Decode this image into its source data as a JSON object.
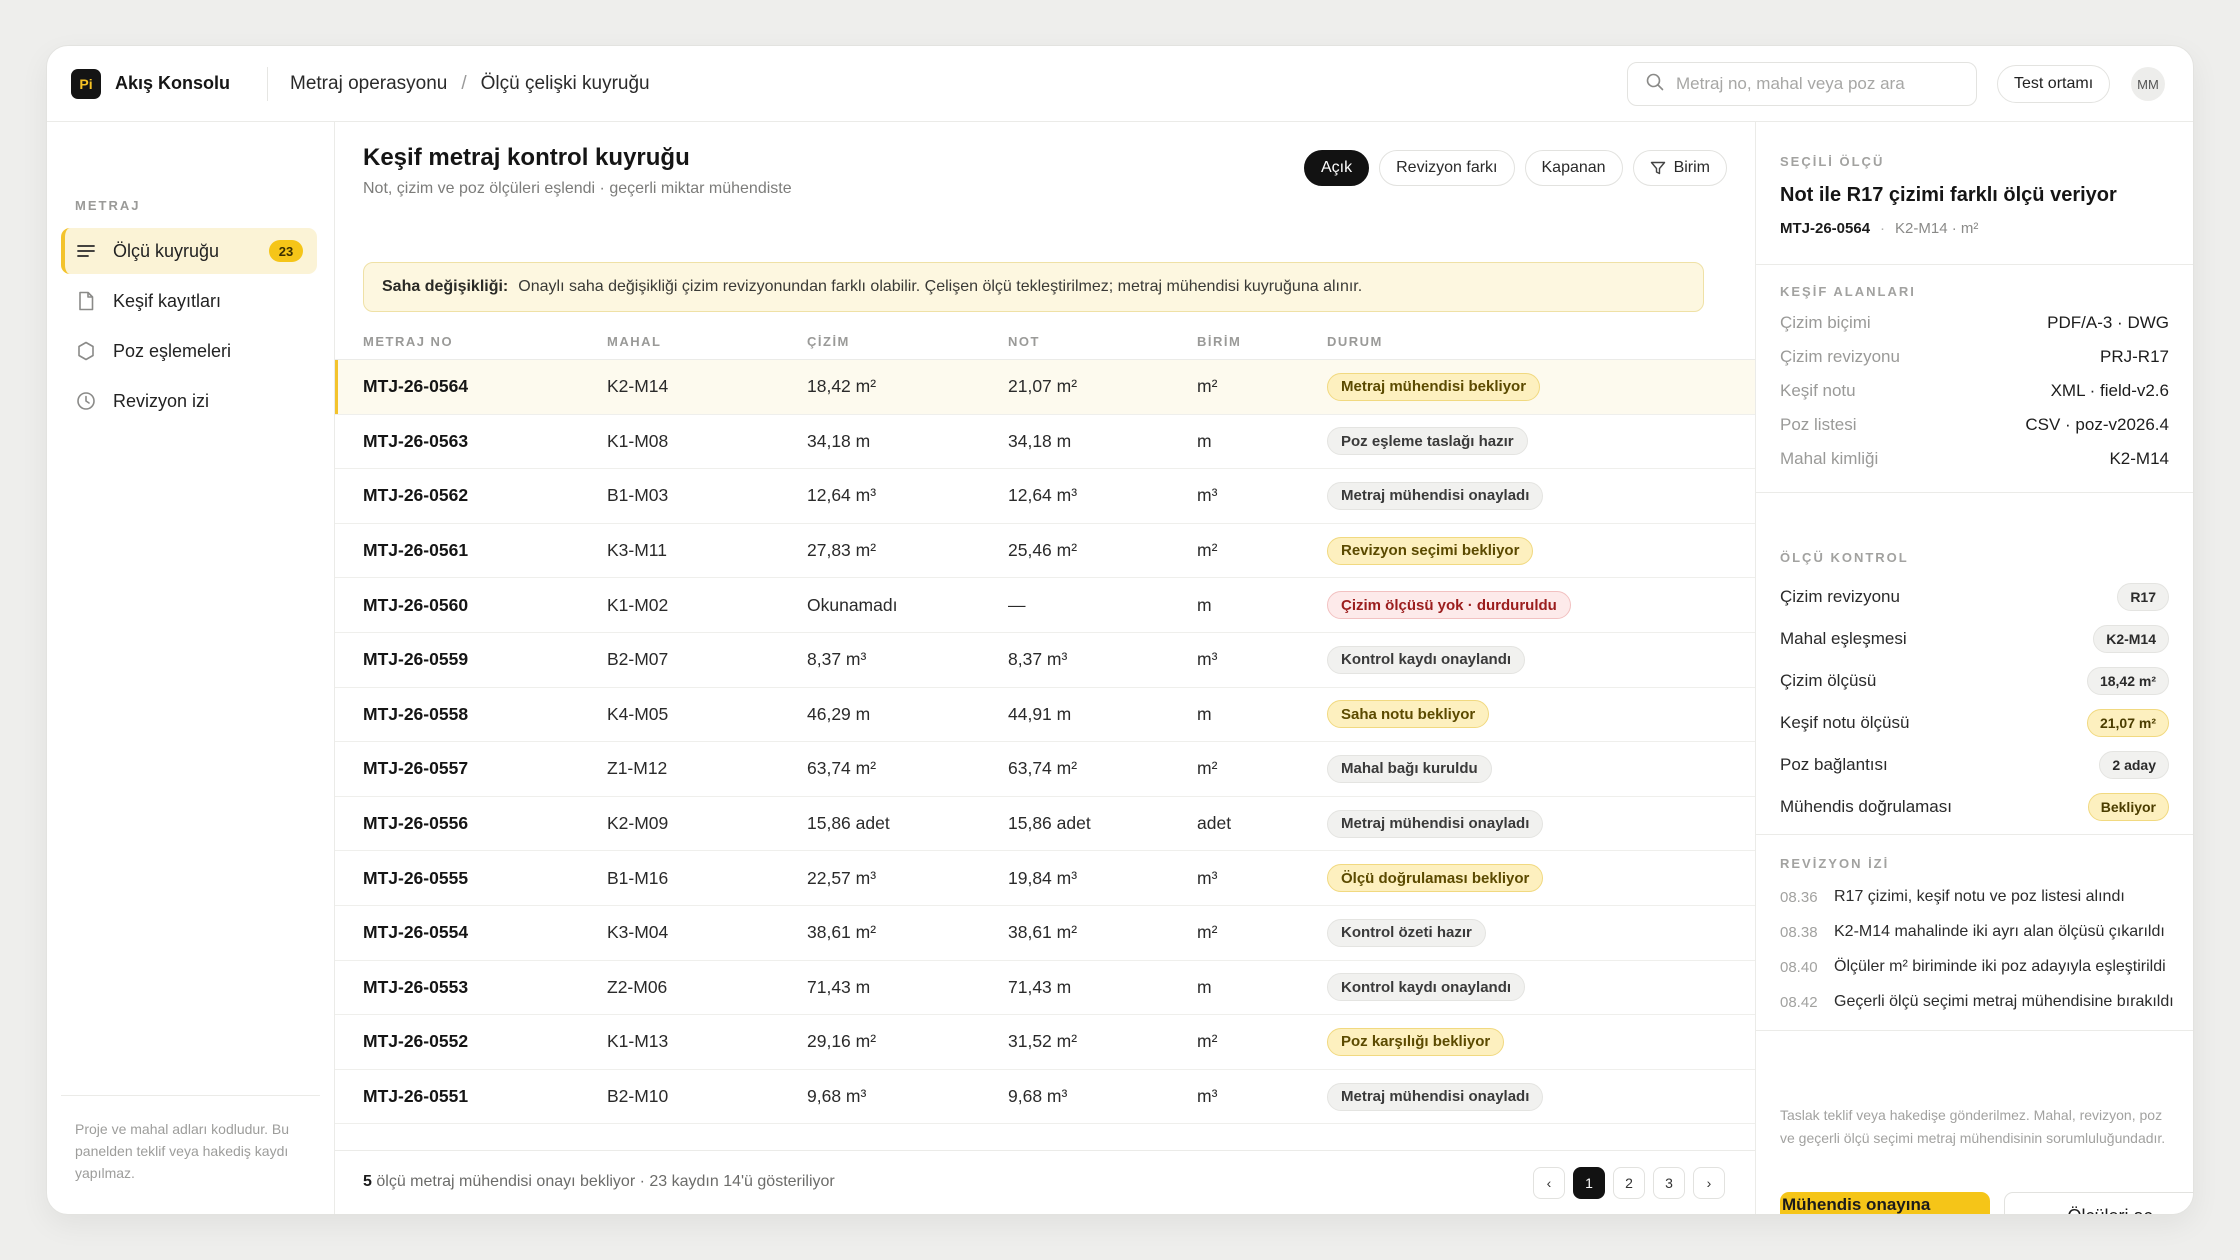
{
  "app": {
    "logo_text": "Pi",
    "brand": "Akış Konsolu",
    "breadcrumb": [
      "Metraj operasyonu",
      "Ölçü çelişki kuyruğu"
    ],
    "breadcrumb_sep": "/",
    "search_placeholder": "Metraj no, mahal veya poz ara",
    "env_label": "Test ortamı",
    "avatar": "MM"
  },
  "sidebar": {
    "heading": "METRAJ",
    "items": [
      {
        "label": "Ölçü kuyruğu",
        "icon": "list-icon",
        "badge": "23",
        "active": true
      },
      {
        "label": "Keşif kayıtları",
        "icon": "document-icon"
      },
      {
        "label": "Poz eşlemeleri",
        "icon": "hexagon-icon"
      },
      {
        "label": "Revizyon izi",
        "icon": "clock-icon"
      }
    ],
    "note": "Proje ve mahal adları kodludur. Bu panelden teklif veya hakediş kaydı yapılmaz."
  },
  "main": {
    "title": "Keşif metraj kontrol kuyruğu",
    "subtitle": "Not, çizim ve poz ölçüleri eşlendi · geçerli miktar mühendiste",
    "filters": [
      "Açık",
      "Revizyon farkı",
      "Kapanan",
      "Birim"
    ],
    "alert": {
      "label": "Saha değişikliği:",
      "text": "Onaylı saha değişikliği çizim revizyonundan farklı olabilir. Çelişen ölçü tekleştirilmez; metraj mühendisi kuyruğuna alınır."
    },
    "columns": [
      "METRAJ NO",
      "MAHAL",
      "ÇİZİM",
      "NOT",
      "BİRİM",
      "DURUM"
    ],
    "rows": [
      {
        "no": "MTJ-26-0564",
        "mahal": "K2-M14",
        "cizim": "18,42 m²",
        "not": "21,07 m²",
        "birim": "m²",
        "durum": "Metraj mühendisi bekliyor",
        "tone": "warn"
      },
      {
        "no": "MTJ-26-0563",
        "mahal": "K1-M08",
        "cizim": "34,18 m",
        "not": "34,18 m",
        "birim": "m",
        "durum": "Poz eşleme taslağı hazır",
        "tone": "neutral"
      },
      {
        "no": "MTJ-26-0562",
        "mahal": "B1-M03",
        "cizim": "12,64 m³",
        "not": "12,64 m³",
        "birim": "m³",
        "durum": "Metraj mühendisi onayladı",
        "tone": "neutral"
      },
      {
        "no": "MTJ-26-0561",
        "mahal": "K3-M11",
        "cizim": "27,83 m²",
        "not": "25,46 m²",
        "birim": "m²",
        "durum": "Revizyon seçimi bekliyor",
        "tone": "warn"
      },
      {
        "no": "MTJ-26-0560",
        "mahal": "K1-M02",
        "cizim": "Okunamadı",
        "not": "—",
        "birim": "m",
        "durum": "Çizim ölçüsü yok · durduruldu",
        "tone": "danger"
      },
      {
        "no": "MTJ-26-0559",
        "mahal": "B2-M07",
        "cizim": "8,37 m³",
        "not": "8,37 m³",
        "birim": "m³",
        "durum": "Kontrol kaydı onaylandı",
        "tone": "neutral"
      },
      {
        "no": "MTJ-26-0558",
        "mahal": "K4-M05",
        "cizim": "46,29 m",
        "not": "44,91 m",
        "birim": "m",
        "durum": "Saha notu bekliyor",
        "tone": "warn"
      },
      {
        "no": "MTJ-26-0557",
        "mahal": "Z1-M12",
        "cizim": "63,74 m²",
        "not": "63,74 m²",
        "birim": "m²",
        "durum": "Mahal bağı kuruldu",
        "tone": "neutral"
      },
      {
        "no": "MTJ-26-0556",
        "mahal": "K2-M09",
        "cizim": "15,86 adet",
        "not": "15,86 adet",
        "birim": "adet",
        "durum": "Metraj mühendisi onayladı",
        "tone": "neutral"
      },
      {
        "no": "MTJ-26-0555",
        "mahal": "B1-M16",
        "cizim": "22,57 m³",
        "not": "19,84 m³",
        "birim": "m³",
        "durum": "Ölçü doğrulaması bekliyor",
        "tone": "warn"
      },
      {
        "no": "MTJ-26-0554",
        "mahal": "K3-M04",
        "cizim": "38,61 m²",
        "not": "38,61 m²",
        "birim": "m²",
        "durum": "Kontrol özeti hazır",
        "tone": "neutral"
      },
      {
        "no": "MTJ-26-0553",
        "mahal": "Z2-M06",
        "cizim": "71,43 m",
        "not": "71,43 m",
        "birim": "m",
        "durum": "Kontrol kaydı onaylandı",
        "tone": "neutral"
      },
      {
        "no": "MTJ-26-0552",
        "mahal": "K1-M13",
        "cizim": "29,16 m²",
        "not": "31,52 m²",
        "birim": "m²",
        "durum": "Poz karşılığı bekliyor",
        "tone": "warn"
      },
      {
        "no": "MTJ-26-0551",
        "mahal": "B2-M10",
        "cizim": "9,68 m³",
        "not": "9,68 m³",
        "birim": "m³",
        "durum": "Metraj mühendisi onayladı",
        "tone": "neutral"
      }
    ],
    "footer": {
      "count": "5",
      "text": "ölçü metraj mühendisi onayı bekliyor · 23 kaydın 14'ü gösteriliyor"
    },
    "pager": {
      "prev": "‹",
      "pages": [
        "1",
        "2",
        "3"
      ],
      "current": "1",
      "next": "›"
    }
  },
  "panel": {
    "eyebrow": "SEÇİLİ ÖLÇÜ",
    "title": "Not ile R17 çizimi farklı ölçü veriyor",
    "id": "MTJ-26-0564",
    "meta": "K2-M14 · m²",
    "meta_dot": "·",
    "fields_heading": "KEŞİF ALANLARI",
    "fields": [
      {
        "k": "Çizim biçimi",
        "v": "PDF/A-3 · DWG"
      },
      {
        "k": "Çizim revizyonu",
        "v": "PRJ-R17"
      },
      {
        "k": "Keşif notu",
        "v": "XML · field-v2.6"
      },
      {
        "k": "Poz listesi",
        "v": "CSV · poz-v2026.4"
      },
      {
        "k": "Mahal kimliği",
        "v": "K2-M14"
      }
    ],
    "checks_heading": "ÖLÇÜ KONTROL",
    "checks": [
      {
        "k": "Çizim revizyonu",
        "v": "R17",
        "tone": "neutral"
      },
      {
        "k": "Mahal eşleşmesi",
        "v": "K2-M14",
        "tone": "neutral"
      },
      {
        "k": "Çizim ölçüsü",
        "v": "18,42 m²",
        "tone": "neutral"
      },
      {
        "k": "Keşif notu ölçüsü",
        "v": "21,07 m²",
        "tone": "warn"
      },
      {
        "k": "Poz bağlantısı",
        "v": "2 aday",
        "tone": "neutral"
      },
      {
        "k": "Mühendis doğrulaması",
        "v": "Bekliyor",
        "tone": "warn"
      }
    ],
    "history_heading": "REVİZYON İZİ",
    "history": [
      {
        "t": "08.36",
        "text": "R17 çizimi, keşif notu ve poz listesi alındı"
      },
      {
        "t": "08.38",
        "text": "K2-M14 mahalinde iki ayrı alan ölçüsü çıkarıldı"
      },
      {
        "t": "08.40",
        "text": "Ölçüler m² biriminde iki poz adayıyla eşleştirildi"
      },
      {
        "t": "08.42",
        "text": "Geçerli ölçü seçimi metraj mühendisine bırakıldı"
      }
    ],
    "note": "Taslak teklif veya hakedişe gönderilmez. Mahal, revizyon, poz ve geçerli ölçü seçimi metraj mühendisinin sorumluluğundadır.",
    "primary_btn": "Mühendis onayına gönder",
    "secondary_btn": "Ölçüleri aç"
  },
  "colors": {
    "accent": "#f5c518",
    "warn_bg": "#fdf0bf",
    "danger_bg": "#fdeaea",
    "dark": "#121212"
  }
}
